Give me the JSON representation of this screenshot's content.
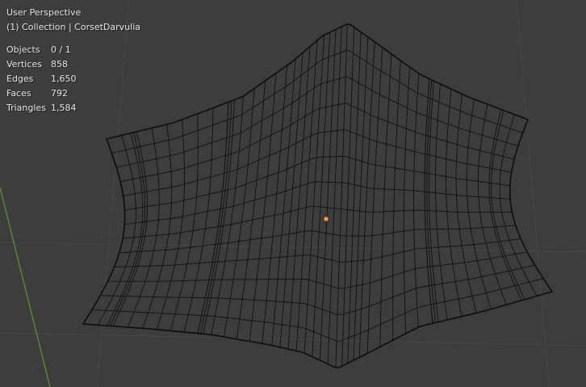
{
  "header": {
    "view_name": "User Perspective",
    "collection_line": "(1) Collection | CorsetDarvulia"
  },
  "statistics": [
    {
      "label": "Objects",
      "value": "0 / 1"
    },
    {
      "label": "Vertices",
      "value": "858"
    },
    {
      "label": "Edges",
      "value": "1,650"
    },
    {
      "label": "Faces",
      "value": "792"
    },
    {
      "label": "Triangles",
      "value": "1,584"
    }
  ],
  "colors": {
    "background": "#3d3d3d",
    "grid_line": "#4a4a4a",
    "y_axis": "#5d8a2e",
    "wire": "#111111",
    "origin": "#f29a3c"
  }
}
